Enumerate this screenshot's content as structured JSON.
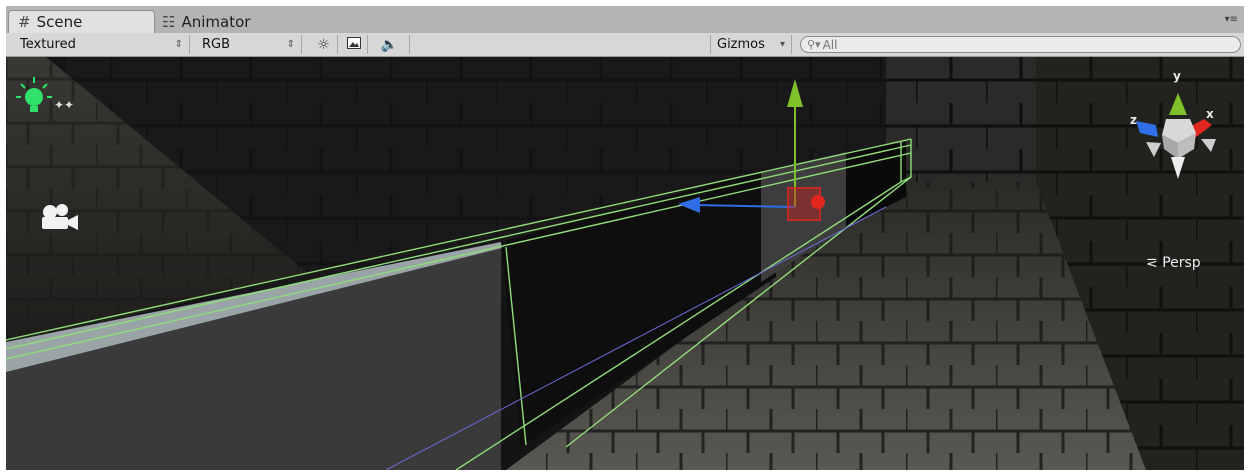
{
  "tabs": [
    {
      "label": "Scene",
      "icon": "grid-icon",
      "active": true
    },
    {
      "label": "Animator",
      "icon": "animator-icon",
      "active": false
    }
  ],
  "toolbar": {
    "shading_mode": "Textured",
    "render_mode": "RGB",
    "gizmos_label": "Gizmos",
    "search_placeholder": "All"
  },
  "orientation_gizmo": {
    "y_label": "y",
    "x_label": "x",
    "z_label": "z",
    "projection_label": "Persp"
  },
  "colors": {
    "y_axis": "#7ec12a",
    "x_axis": "#e0261f",
    "z_axis": "#2f6ee6",
    "selection_wire": "#8fdc7a"
  }
}
